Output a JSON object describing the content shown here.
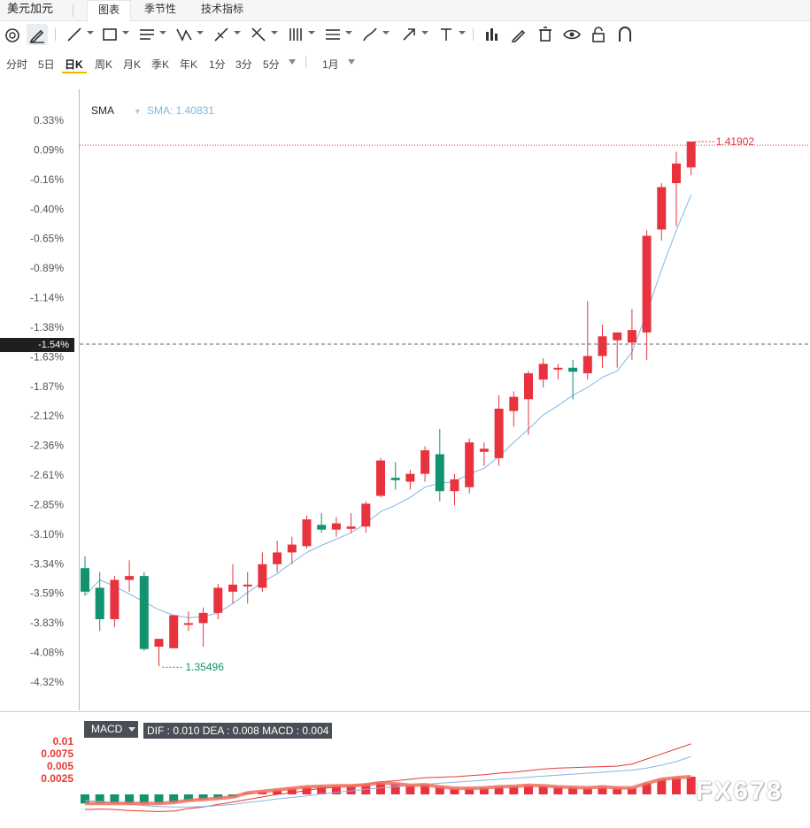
{
  "app": {
    "title": "美元加元",
    "tabs": [
      {
        "label": "图表",
        "active": true
      },
      {
        "label": "季节性",
        "active": false
      },
      {
        "label": "技术指标",
        "active": false
      }
    ]
  },
  "toolbar": {
    "icons": [
      "magnet-icon",
      "pencil-icon",
      "line-icon",
      "rectangle-icon",
      "parallel-lines-icon",
      "pattern-icon",
      "fork-icon",
      "cross-lines-icon",
      "fib-icon",
      "channel-icon",
      "brush-icon",
      "arrow-icon",
      "text-icon",
      "bar-chart-icon",
      "edit-icon",
      "trash-icon",
      "eye-icon",
      "lock-icon",
      "magnet-u-icon"
    ]
  },
  "periods": {
    "items": [
      "分时",
      "5日",
      "日K",
      "周K",
      "月K",
      "季K",
      "年K",
      "1分",
      "3分",
      "5分"
    ],
    "active": "日K",
    "range": "1月"
  },
  "indicator": {
    "name": "SMA",
    "value_label": "SMA: 1.40831"
  },
  "current_label": "-1.54%",
  "annotations": {
    "high": "1.41902",
    "low": "1.35496"
  },
  "macd": {
    "button": "MACD",
    "values": "DIF : 0.010  DEA : 0.008  MACD : 0.004",
    "ticks": [
      "0.01",
      "0.0075",
      "0.005",
      "0.0025"
    ]
  },
  "watermark": "FX678",
  "colors": {
    "up": "#e8333f",
    "down": "#12926e",
    "sma": "#78b9e8",
    "macd_line": "#f07060",
    "dif_line": "#e53935",
    "dea_line": "#8ab4e0"
  },
  "chart_data": {
    "type": "candlestick",
    "y_axis_percent_ticks": [
      "0.33%",
      "0.09%",
      "-0.16%",
      "-0.40%",
      "-0.65%",
      "-0.89%",
      "-1.14%",
      "-1.38%",
      "-1.63%",
      "-1.87%",
      "-2.12%",
      "-2.36%",
      "-2.61%",
      "-2.85%",
      "-3.10%",
      "-3.34%",
      "-3.59%",
      "-3.83%",
      "-4.08%",
      "-4.32%"
    ],
    "price_range": [
      1.351,
      1.4225
    ],
    "candles": [
      {
        "o": 1.3655,
        "h": 1.367,
        "l": 1.362,
        "c": 1.3625
      },
      {
        "o": 1.363,
        "h": 1.365,
        "l": 1.3575,
        "c": 1.359
      },
      {
        "o": 1.359,
        "h": 1.3645,
        "l": 1.358,
        "c": 1.364
      },
      {
        "o": 1.364,
        "h": 1.3665,
        "l": 1.3625,
        "c": 1.3645
      },
      {
        "o": 1.3645,
        "h": 1.365,
        "l": 1.355,
        "c": 1.3552
      },
      {
        "o": 1.3555,
        "h": 1.356,
        "l": 1.353,
        "c": 1.3565
      },
      {
        "o": 1.3553,
        "h": 1.3595,
        "l": 1.3553,
        "c": 1.3595
      },
      {
        "o": 1.3585,
        "h": 1.36,
        "l": 1.3575,
        "c": 1.3585
      },
      {
        "o": 1.3585,
        "h": 1.3605,
        "l": 1.3555,
        "c": 1.3598
      },
      {
        "o": 1.3598,
        "h": 1.3635,
        "l": 1.359,
        "c": 1.363
      },
      {
        "o": 1.3625,
        "h": 1.366,
        "l": 1.361,
        "c": 1.3634
      },
      {
        "o": 1.3634,
        "h": 1.365,
        "l": 1.361,
        "c": 1.3634
      },
      {
        "o": 1.363,
        "h": 1.3675,
        "l": 1.3625,
        "c": 1.366
      },
      {
        "o": 1.366,
        "h": 1.369,
        "l": 1.365,
        "c": 1.3675
      },
      {
        "o": 1.3675,
        "h": 1.3695,
        "l": 1.366,
        "c": 1.3685
      },
      {
        "o": 1.3683,
        "h": 1.3722,
        "l": 1.368,
        "c": 1.3717
      },
      {
        "o": 1.371,
        "h": 1.3725,
        "l": 1.37,
        "c": 1.3704
      },
      {
        "o": 1.3704,
        "h": 1.372,
        "l": 1.3695,
        "c": 1.3712
      },
      {
        "o": 1.3705,
        "h": 1.3725,
        "l": 1.37,
        "c": 1.3708
      },
      {
        "o": 1.3708,
        "h": 1.374,
        "l": 1.37,
        "c": 1.3737
      },
      {
        "o": 1.3747,
        "h": 1.3795,
        "l": 1.3745,
        "c": 1.3792
      },
      {
        "o": 1.377,
        "h": 1.379,
        "l": 1.3755,
        "c": 1.3767
      },
      {
        "o": 1.3765,
        "h": 1.378,
        "l": 1.3755,
        "c": 1.3775
      },
      {
        "o": 1.3775,
        "h": 1.381,
        "l": 1.3765,
        "c": 1.3805
      },
      {
        "o": 1.38,
        "h": 1.3832,
        "l": 1.374,
        "c": 1.3753
      },
      {
        "o": 1.3753,
        "h": 1.3775,
        "l": 1.3735,
        "c": 1.3768
      },
      {
        "o": 1.3758,
        "h": 1.382,
        "l": 1.375,
        "c": 1.3815
      },
      {
        "o": 1.3803,
        "h": 1.3815,
        "l": 1.3785,
        "c": 1.3807
      },
      {
        "o": 1.3795,
        "h": 1.3875,
        "l": 1.3785,
        "c": 1.3858
      },
      {
        "o": 1.3855,
        "h": 1.388,
        "l": 1.3835,
        "c": 1.3873
      },
      {
        "o": 1.387,
        "h": 1.3906,
        "l": 1.3825,
        "c": 1.3903
      },
      {
        "o": 1.3895,
        "h": 1.3922,
        "l": 1.3885,
        "c": 1.3915
      },
      {
        "o": 1.391,
        "h": 1.3915,
        "l": 1.3895,
        "c": 1.391
      },
      {
        "o": 1.391,
        "h": 1.392,
        "l": 1.387,
        "c": 1.3905
      },
      {
        "o": 1.3903,
        "h": 1.3995,
        "l": 1.3895,
        "c": 1.3925
      },
      {
        "o": 1.3925,
        "h": 1.3965,
        "l": 1.391,
        "c": 1.395
      },
      {
        "o": 1.3945,
        "h": 1.3955,
        "l": 1.391,
        "c": 1.3955
      },
      {
        "o": 1.3942,
        "h": 1.3985,
        "l": 1.392,
        "c": 1.3958
      },
      {
        "o": 1.3955,
        "h": 1.4085,
        "l": 1.392,
        "c": 1.4078
      },
      {
        "o": 1.4086,
        "h": 1.4145,
        "l": 1.4072,
        "c": 1.414
      },
      {
        "o": 1.4145,
        "h": 1.4185,
        "l": 1.409,
        "c": 1.417
      },
      {
        "o": 1.4165,
        "h": 1.419,
        "l": 1.4155,
        "c": 1.4198
      }
    ],
    "sma": [
      1.362,
      1.364,
      1.3632,
      1.3622,
      1.3612,
      1.3602,
      1.3595,
      1.3592,
      1.3593,
      1.3598,
      1.361,
      1.3624,
      1.3637,
      1.3648,
      1.3662,
      1.3675,
      1.3684,
      1.3692,
      1.37,
      1.3712,
      1.3727,
      1.3735,
      1.3745,
      1.3758,
      1.3763,
      1.3765,
      1.3775,
      1.3782,
      1.3797,
      1.3815,
      1.3832,
      1.385,
      1.3862,
      1.3875,
      1.3885,
      1.3898,
      1.3906,
      1.393,
      1.398,
      1.4035,
      1.4085,
      1.413
    ],
    "macd_hist": [
      -0.0018,
      -0.0018,
      -0.0018,
      -0.0018,
      -0.0018,
      -0.0018,
      -0.0016,
      -0.0012,
      -0.001,
      -0.0008,
      -0.0005,
      0.0003,
      0.0006,
      0.0009,
      0.0012,
      0.0015,
      0.0016,
      0.0017,
      0.0017,
      0.0019,
      0.0023,
      0.0021,
      0.0018,
      0.0019,
      0.0015,
      0.0012,
      0.0012,
      0.0013,
      0.0015,
      0.0016,
      0.0018,
      0.0017,
      0.0015,
      0.0014,
      0.0013,
      0.0015,
      0.0013,
      0.0013,
      0.0022,
      0.003,
      0.0033,
      0.0035
    ],
    "macd_dif": [
      -0.003,
      -0.0029,
      -0.003,
      -0.0032,
      -0.0033,
      -0.0034,
      -0.0033,
      -0.0028,
      -0.0025,
      -0.002,
      -0.0015,
      -0.001,
      -0.0005,
      0.0,
      0.0003,
      0.0008,
      0.0012,
      0.0014,
      0.0017,
      0.002,
      0.0025,
      0.0027,
      0.003,
      0.0033,
      0.0034,
      0.0035,
      0.0037,
      0.0039,
      0.0042,
      0.0044,
      0.0047,
      0.005,
      0.0052,
      0.0053,
      0.0054,
      0.0055,
      0.0056,
      0.006,
      0.007,
      0.008,
      0.009,
      0.01
    ],
    "macd_dea": [
      -0.0012,
      -0.0014,
      -0.0016,
      -0.0019,
      -0.0022,
      -0.0024,
      -0.0025,
      -0.0025,
      -0.0024,
      -0.0022,
      -0.002,
      -0.0016,
      -0.0013,
      -0.0009,
      -0.0006,
      -0.0003,
      0.0001,
      0.0004,
      0.0007,
      0.001,
      0.0013,
      0.0015,
      0.0018,
      0.002,
      0.0022,
      0.0024,
      0.0026,
      0.0028,
      0.003,
      0.0032,
      0.0034,
      0.0036,
      0.0038,
      0.004,
      0.0042,
      0.0044,
      0.0046,
      0.0048,
      0.0052,
      0.0058,
      0.0065,
      0.0075
    ],
    "macd_range": [
      -0.0035,
      0.0105
    ]
  }
}
